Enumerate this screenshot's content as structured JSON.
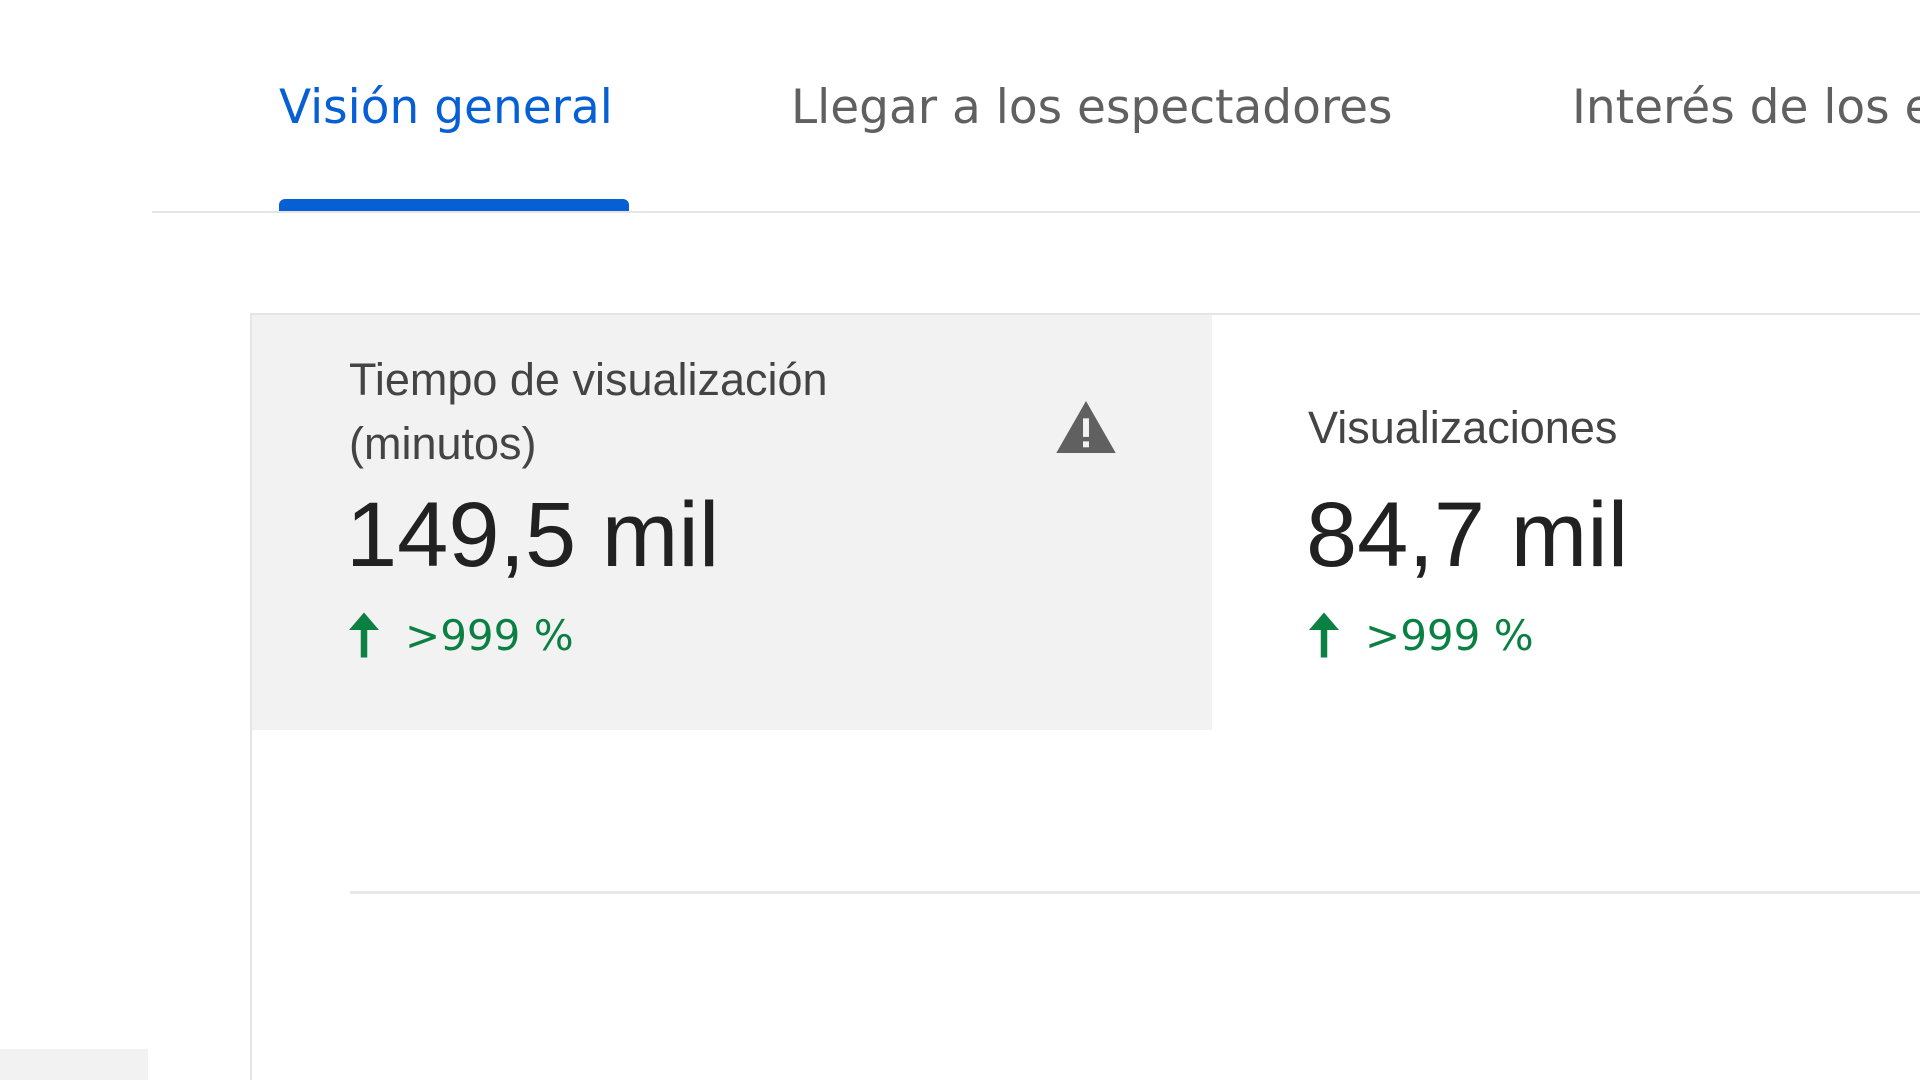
{
  "tabs": [
    {
      "label": "Visión general",
      "active": true
    },
    {
      "label": "Llegar a los espectadores",
      "active": false
    },
    {
      "label": "Interés de los espectadores",
      "active": false
    }
  ],
  "metrics": [
    {
      "label_line1": "Tiempo de visualización",
      "label_line2": "(minutos)",
      "value": "149,5 mil",
      "change": ">999 %",
      "change_direction": "up",
      "icon": "warning-icon",
      "selected": true
    },
    {
      "label_line1": "Visualizaciones",
      "value": "84,7 mil",
      "change": ">999 %",
      "change_direction": "up",
      "icon": "warning-icon",
      "selected": false
    }
  ],
  "colors": {
    "accent": "#065fd4",
    "positive": "#0b8043",
    "selected_bg": "#f2f2f2",
    "warning_icon": "#606060"
  }
}
